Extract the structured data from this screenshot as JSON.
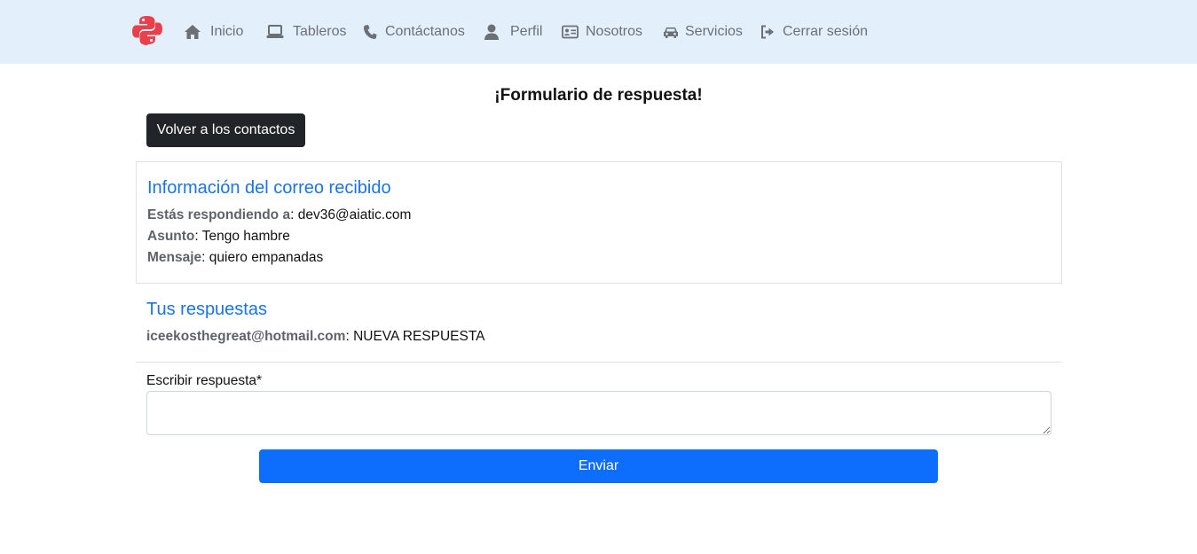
{
  "nav": {
    "brand_icon": "python-logo-icon",
    "brand_color": "#e8414b",
    "items": [
      {
        "label": "Inicio",
        "icon": "home-icon"
      },
      {
        "label": "Tableros",
        "icon": "laptop-icon"
      },
      {
        "label": "Contáctanos",
        "icon": "phone-icon"
      },
      {
        "label": "Perfil",
        "icon": "user-icon"
      },
      {
        "label": "Nosotros",
        "icon": "id-card-icon"
      },
      {
        "label": "Servicios",
        "icon": "car-icon"
      },
      {
        "label": "Cerrar sesión",
        "icon": "sign-out-icon"
      }
    ]
  },
  "page": {
    "title": "¡Formulario de respuesta!",
    "back_button": "Volver a los contactos"
  },
  "email_info": {
    "heading": "Información del correo recibido",
    "to_label": "Estás respondiendo a",
    "to_value": "dev36@aiatic.com",
    "subject_label": "Asunto",
    "subject_value": "Tengo hambre",
    "message_label": "Mensaje",
    "message_value": "quiero empanadas"
  },
  "responses": {
    "heading": "Tus respuestas",
    "items": [
      {
        "author": "iceekosthegreat@hotmail.com",
        "text": "NUEVA RESPUESTA"
      }
    ]
  },
  "form": {
    "reply_label": "Escribir respuesta*",
    "reply_value": "",
    "submit": "Enviar"
  },
  "colors": {
    "navbar_bg": "#e3f0fc",
    "accent_blue": "#0d6efd",
    "heading_blue": "#1a73e8",
    "dark_button": "#212529"
  }
}
